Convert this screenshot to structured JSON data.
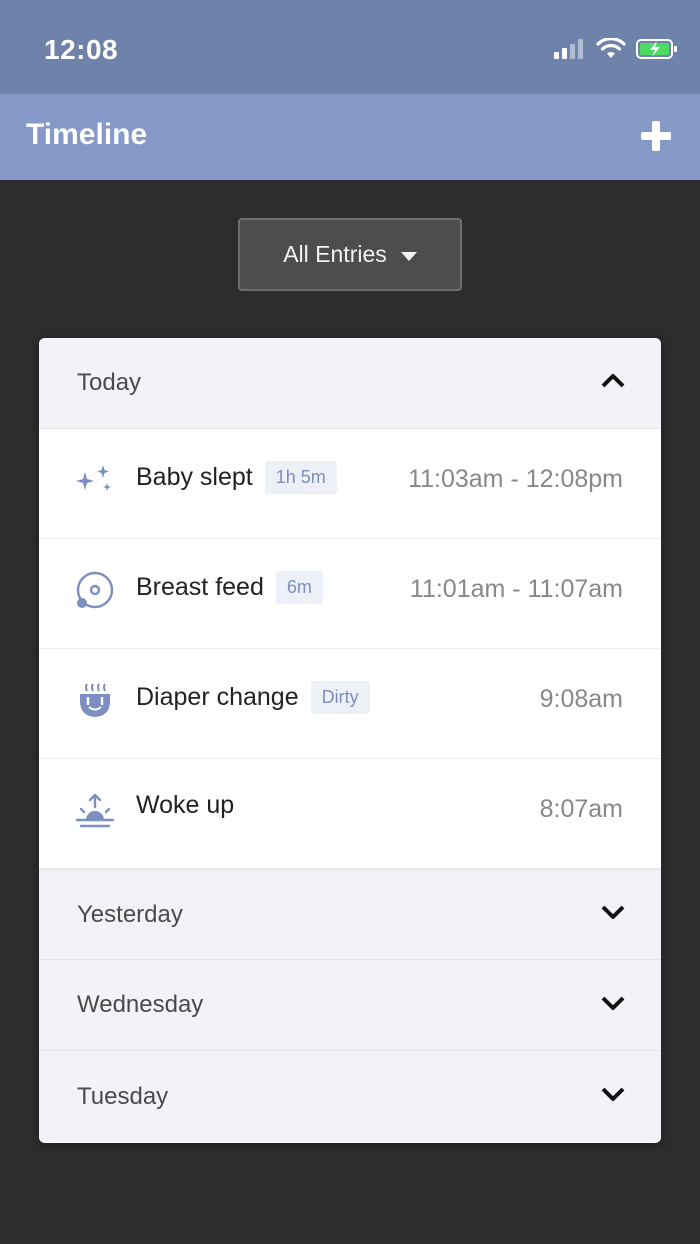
{
  "status": {
    "time": "12:08"
  },
  "nav": {
    "title": "Timeline"
  },
  "filter": {
    "label": "All Entries"
  },
  "colors": {
    "accent": "#8598c8",
    "status_bar": "#6f82aa",
    "background": "#2d2d2d",
    "icon": "#7d8fc2",
    "battery": "#4cd964"
  },
  "sections": [
    {
      "label": "Today",
      "expanded": true,
      "entries": [
        {
          "icon": "sparkles-icon",
          "title": "Baby slept",
          "badge": "1h 5m",
          "time": "11:03am - 12:08pm"
        },
        {
          "icon": "breast-feed-icon",
          "title": "Breast feed",
          "badge": "6m",
          "time": "11:01am - 11:07am"
        },
        {
          "icon": "diaper-icon",
          "title": "Diaper change",
          "badge": "Dirty",
          "time": "9:08am"
        },
        {
          "icon": "sunrise-icon",
          "title": "Woke up",
          "badge": "",
          "time": "8:07am"
        }
      ]
    },
    {
      "label": "Yesterday",
      "expanded": false
    },
    {
      "label": "Wednesday",
      "expanded": false
    },
    {
      "label": "Tuesday",
      "expanded": false
    }
  ]
}
